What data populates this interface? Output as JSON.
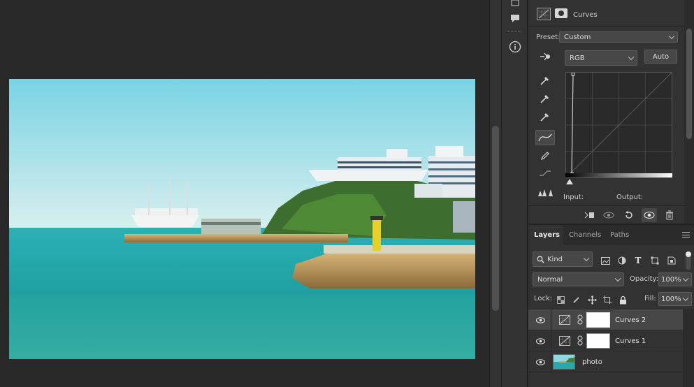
{
  "properties": {
    "title": "Curves",
    "preset_label": "Preset:",
    "preset_value": "Custom",
    "channel_value": "RGB",
    "auto_label": "Auto",
    "input_label": "Input:",
    "output_label": "Output:"
  },
  "layers_panel": {
    "tabs": [
      {
        "label": "Layers"
      },
      {
        "label": "Channels"
      },
      {
        "label": "Paths"
      }
    ],
    "filter_kind": "Kind",
    "blend_mode": "Normal",
    "opacity_label": "Opacity:",
    "opacity_value": "100%",
    "lock_label": "Lock:",
    "fill_label": "Fill:",
    "fill_value": "100%",
    "layers": [
      {
        "name": "Curves 2"
      },
      {
        "name": "Curves 1"
      },
      {
        "name": "photo"
      }
    ]
  },
  "colors": {
    "panel_bg": "#323232",
    "app_bg": "#282828",
    "selected_row": "#474747"
  }
}
